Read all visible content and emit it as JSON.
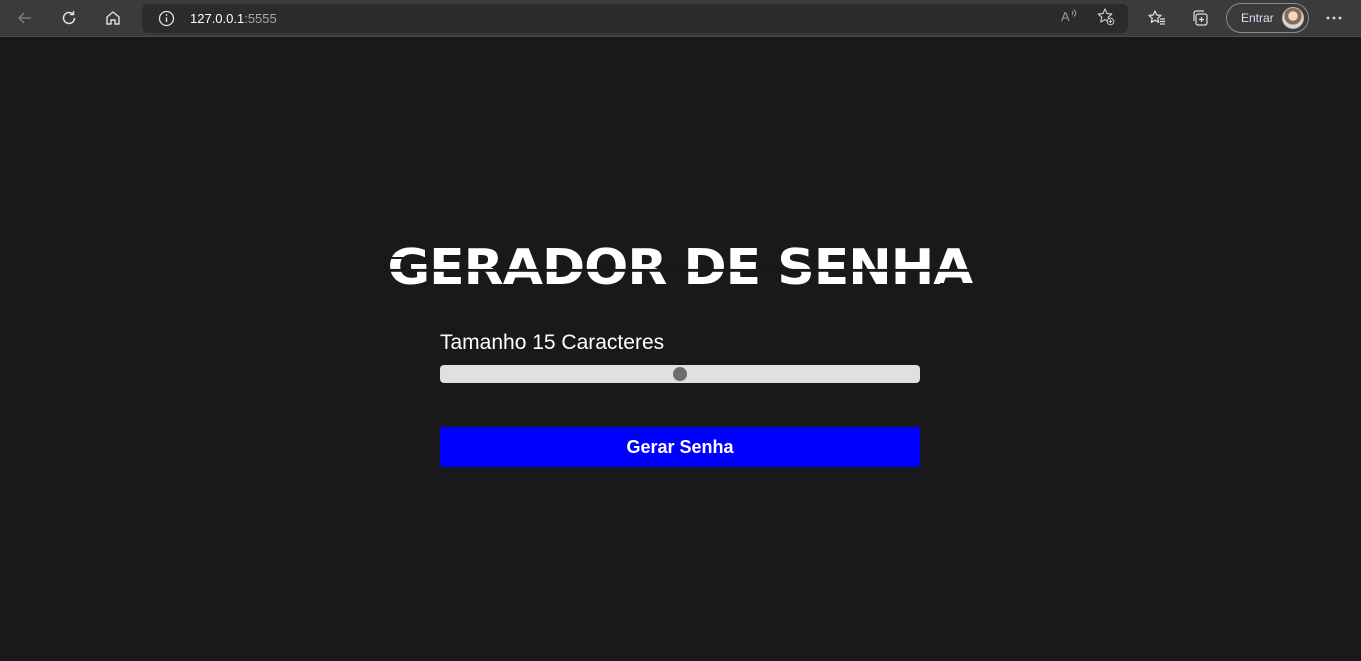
{
  "browser": {
    "url_host": "127.0.0.1",
    "url_port": ":5555",
    "signin_label": "Entrar"
  },
  "page": {
    "title": "GERADOR DE SENHA",
    "size_label": "Tamanho 15 Caracteres",
    "slider_fraction": 0.5,
    "generate_button": "Gerar Senha"
  },
  "colors": {
    "background": "#19191b",
    "button": "#0000ff",
    "slider_track": "#e0e0e0",
    "slider_thumb": "#6e6e6e"
  }
}
